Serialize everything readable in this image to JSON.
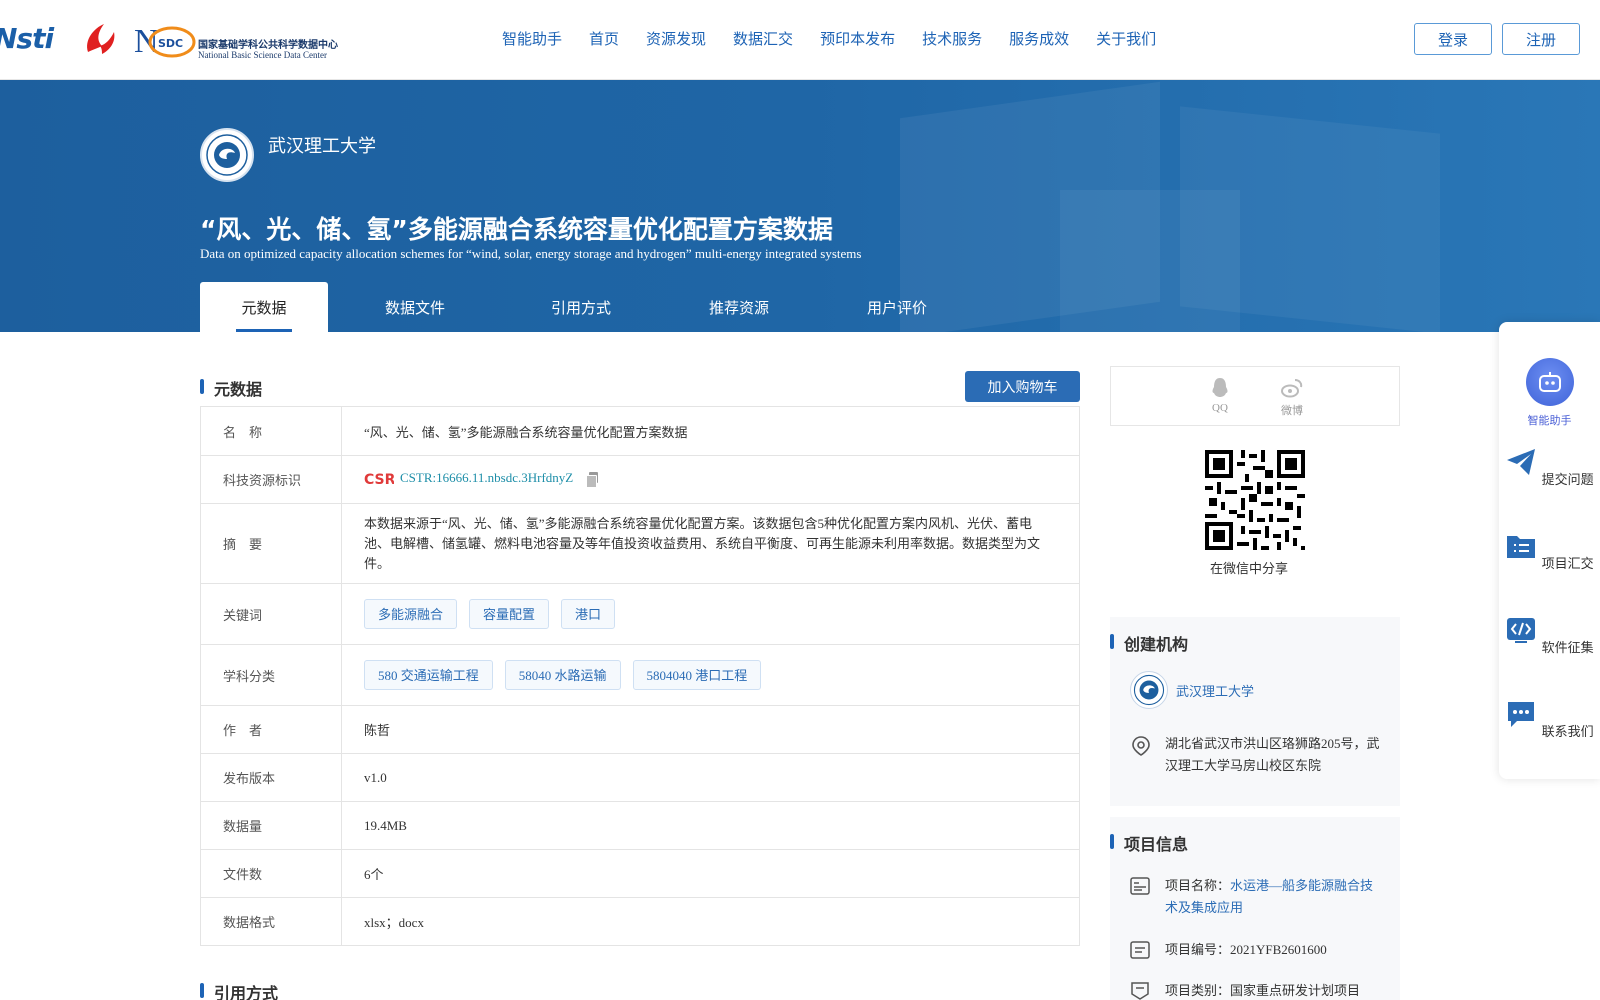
{
  "header": {
    "logo_nstl_text": "Nsti",
    "logo_nsdc_cn": "国家基础学科公共科学数据中心",
    "logo_nsdc_en": "National Basic Science Data Center",
    "logo_nsdc_abbr": "SDC",
    "nav": [
      "智能助手",
      "首页",
      "资源发现",
      "数据汇交",
      "预印本发布",
      "技术服务",
      "服务成效",
      "关于我们"
    ],
    "login_label": "登录",
    "register_label": "注册",
    "accent_color": "#1d63b5"
  },
  "banner": {
    "institution": "武汉理工大学",
    "title": "“风、光、储、氢”多能源融合系统容量优化配置方案数据",
    "subtitle": "Data on optimized capacity allocation schemes for “wind, solar, energy storage and hydrogen” multi-energy integrated systems",
    "tabs": [
      "元数据",
      "数据文件",
      "引用方式",
      "推荐资源",
      "用户评价"
    ],
    "active_tab": "元数据"
  },
  "metadata": {
    "section_title": "元数据",
    "cart_button": "加入购物车",
    "rows": {
      "name": {
        "key": "名　称",
        "value": "“风、光、储、氢”多能源融合系统容量优化配置方案数据"
      },
      "cstr": {
        "key": "科技资源标识",
        "value": "CSTR:16666.11.nbsdc.3HrfdnyZ",
        "badge": "CSR"
      },
      "abstract": {
        "key": "摘　要",
        "value": "本数据来源于“风、光、储、氢”多能源融合系统容量优化配置方案。该数据包含5种优化配置方案内风机、光伏、蓄电池、电解槽、储氢罐、燃料电池容量及等年值投资收益费用、系统自平衡度、可再生能源未利用率数据。数据类型为文件。"
      },
      "keywords": {
        "key": "关键词",
        "tags": [
          "多能源融合",
          "容量配置",
          "港口"
        ]
      },
      "subject": {
        "key": "学科分类",
        "tags": [
          "580 交通运输工程",
          "58040 水路运输",
          "5804040 港口工程"
        ]
      },
      "author": {
        "key": "作　者",
        "value": "陈哲"
      },
      "version": {
        "key": "发布版本",
        "value": "v1.0"
      },
      "size": {
        "key": "数据量",
        "value": "19.4MB"
      },
      "files": {
        "key": "文件数",
        "value": "6个"
      },
      "format": {
        "key": "数据格式",
        "value": "xlsx；docx"
      }
    },
    "next_section_title": "引用方式"
  },
  "sidebar": {
    "share": {
      "qq": "QQ",
      "weibo": "微博",
      "wechat_caption": "在微信中分享"
    },
    "org": {
      "title": "创建机构",
      "name": "武汉理工大学",
      "address": "湖北省武汉市洪山区珞狮路205号，武汉理工大学马房山校区东院"
    },
    "project": {
      "title": "项目信息",
      "name_label": "项目名称：",
      "name_value": "水运港—船多能源融合技术及集成应用",
      "code_label": "项目编号：",
      "code_value": "2021YFB2601600",
      "type_label": "项目类别：",
      "type_value": "国家重点研发计划项目"
    }
  },
  "floatbar": {
    "items": [
      "智能助手",
      "提交问题",
      "项目汇交",
      "软件征集",
      "联系我们"
    ]
  }
}
